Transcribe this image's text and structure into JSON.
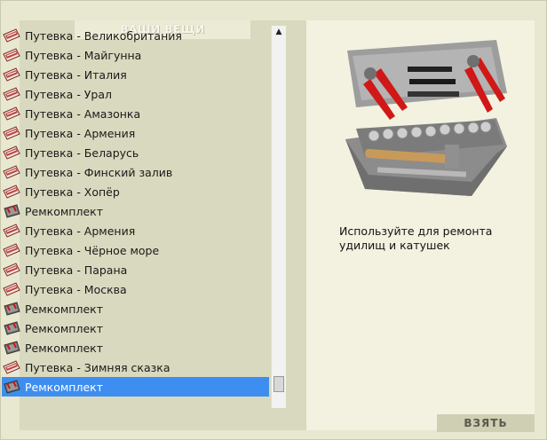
{
  "panel": {
    "title": "ВАШИ ВЕЩИ"
  },
  "items": [
    {
      "label": "Путевка - Великобритания",
      "icon": "voucher-icon"
    },
    {
      "label": "Путевка - Майгунна",
      "icon": "voucher-icon"
    },
    {
      "label": "Путевка - Италия",
      "icon": "voucher-icon"
    },
    {
      "label": "Путевка - Урал",
      "icon": "voucher-icon"
    },
    {
      "label": "Путевка - Амазонка",
      "icon": "voucher-icon"
    },
    {
      "label": "Путевка - Армения",
      "icon": "voucher-icon"
    },
    {
      "label": "Путевка - Беларусь",
      "icon": "voucher-icon"
    },
    {
      "label": "Путевка - Финский залив",
      "icon": "voucher-icon"
    },
    {
      "label": "Путевка - Хопёр",
      "icon": "voucher-icon"
    },
    {
      "label": "Ремкомплект",
      "icon": "repair-kit-icon"
    },
    {
      "label": "Путевка - Армения",
      "icon": "voucher-icon"
    },
    {
      "label": "Путевка - Чёрное море",
      "icon": "voucher-icon"
    },
    {
      "label": "Путевка - Парана",
      "icon": "voucher-icon"
    },
    {
      "label": "Путевка - Москва",
      "icon": "voucher-icon"
    },
    {
      "label": "Ремкомплект",
      "icon": "repair-kit-icon"
    },
    {
      "label": "Ремкомплект",
      "icon": "repair-kit-icon"
    },
    {
      "label": "Ремкомплект",
      "icon": "repair-kit-icon"
    },
    {
      "label": "Путевка - Зимняя сказка",
      "icon": "voucher-icon"
    },
    {
      "label": "Ремкомплект",
      "icon": "repair-kit-icon",
      "selected": true
    }
  ],
  "detail": {
    "image": "toolbox-image",
    "description": "Используйте для ремонта удилищ и катушек"
  },
  "actions": {
    "take_label": "ВЗЯТЬ"
  },
  "colors": {
    "selection": "#3d8ef0",
    "panel_bg": "#d9d9bf",
    "detail_bg": "#f3f2e0",
    "button_bg": "#cfcfb4"
  }
}
